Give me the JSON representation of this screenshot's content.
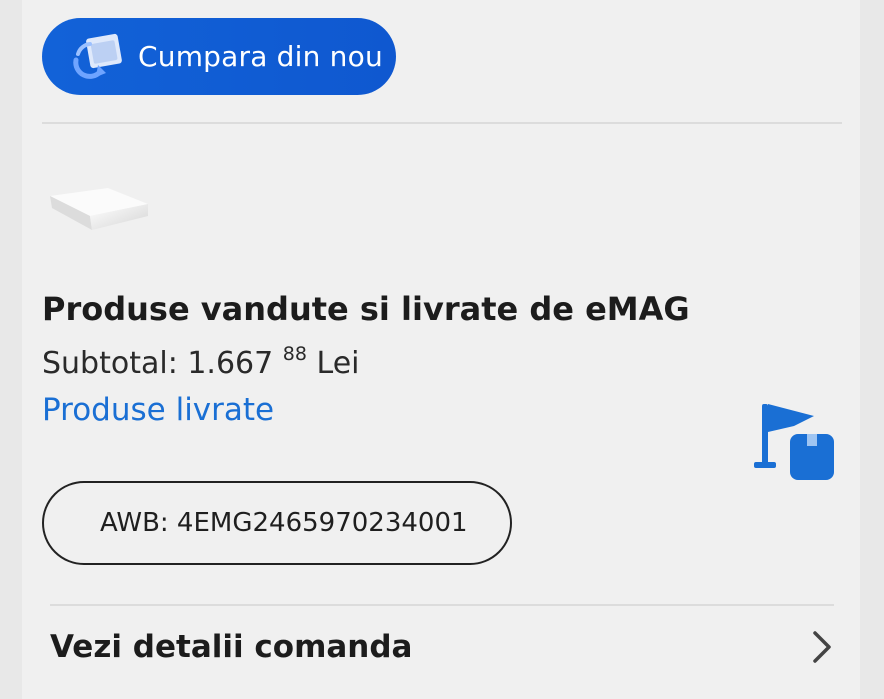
{
  "reorder": {
    "label": "Cumpara din nou",
    "icon": "box-reload-icon"
  },
  "order_group": {
    "title": "Produse vandute si livrate de eMAG",
    "subtotal_prefix": "Subtotal: 1.667",
    "subtotal_cents": "88",
    "subtotal_currency": "Lei",
    "status": "Produse livrate",
    "status_color": "#1a6fd4",
    "status_icon": "flag-package-icon",
    "awb": "AWB: 4EMG2465970234001"
  },
  "details": {
    "label": "Vezi detalii comanda",
    "icon": "chevron-right-icon"
  },
  "colors": {
    "accent": "#1262d8",
    "background": "#f0f0f0"
  }
}
